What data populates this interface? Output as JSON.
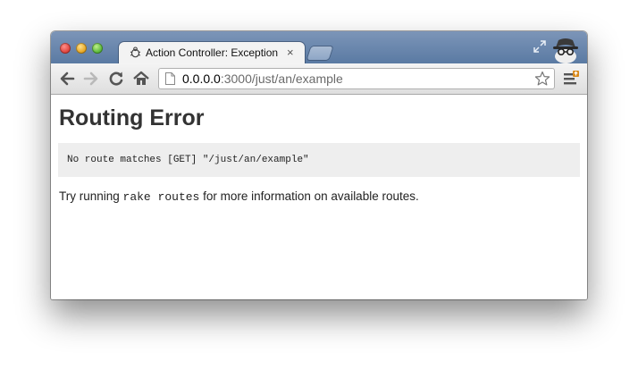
{
  "window": {
    "controls": [
      "close",
      "minimize",
      "zoom"
    ]
  },
  "tab": {
    "title": "Action Controller: Exception",
    "favicon": "bug-icon",
    "close_glyph": "×"
  },
  "toolbar": {
    "back_icon": "back-arrow-icon",
    "forward_icon": "forward-arrow-icon",
    "reload_icon": "reload-icon",
    "home_icon": "home-icon",
    "url_host": "0.0.0.0",
    "url_rest": ":3000/just/an/example",
    "bookmark_icon": "star-icon",
    "menu_icon": "wrench-menu-icon",
    "incognito_icon": "incognito-spy-icon"
  },
  "page": {
    "heading": "Routing Error",
    "message": "No route matches [GET] \"/just/an/example\"",
    "help_before": "Try running ",
    "help_code": "rake routes",
    "help_after": " for more information on available routes."
  }
}
